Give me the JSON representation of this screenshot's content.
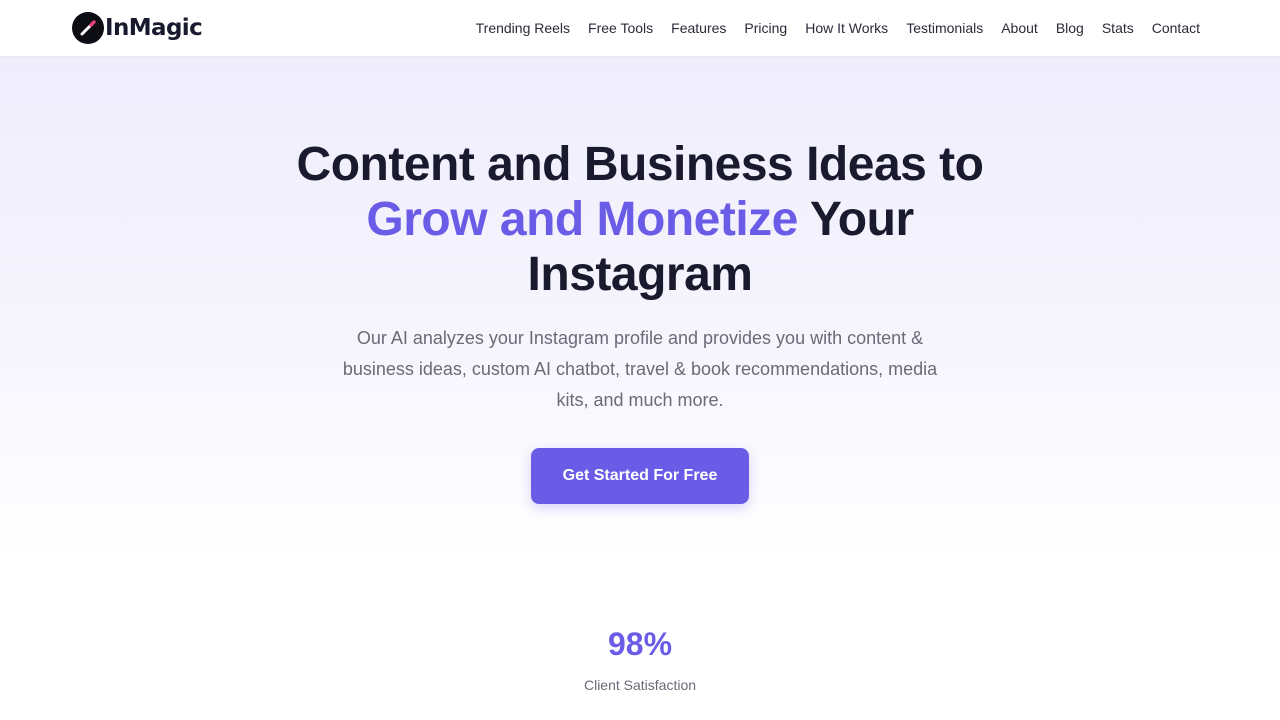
{
  "brand": {
    "name": "InMagic",
    "logo_icon": "magic-wand-icon",
    "logo_bg": "#0d0d14",
    "wand_color": "#ffffff",
    "wand_tip_color": "#e8457a"
  },
  "nav": {
    "items": [
      {
        "label": "Trending Reels"
      },
      {
        "label": "Free Tools"
      },
      {
        "label": "Features"
      },
      {
        "label": "Pricing"
      },
      {
        "label": "How It Works"
      },
      {
        "label": "Testimonials"
      },
      {
        "label": "About"
      },
      {
        "label": "Blog"
      },
      {
        "label": "Stats"
      },
      {
        "label": "Contact"
      }
    ]
  },
  "hero": {
    "title_line1": "Content and Business Ideas to",
    "title_accent": "Grow and Monetize",
    "title_line2_rest": " Your",
    "title_line3": "Instagram",
    "subtitle": "Our AI analyzes your Instagram profile and provides you with content & business ideas, custom AI chatbot, travel & book recommendations, media kits, and much more.",
    "cta_label": "Get Started For Free"
  },
  "stats": [
    {
      "value": "98%",
      "label": "Client Satisfaction"
    }
  ],
  "colors": {
    "accent": "#6b5ce7",
    "heading": "#1a1a2e",
    "body_text": "#6a6a78",
    "hero_bg_top": "#efedfc"
  }
}
